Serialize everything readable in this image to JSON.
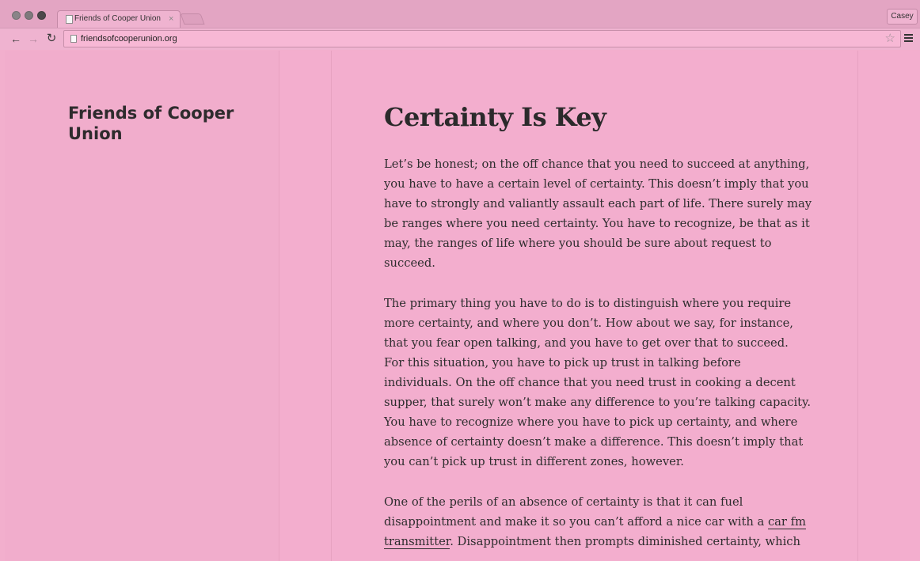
{
  "browser": {
    "tab_title": "Friends of Cooper Union",
    "tab_close": "×",
    "profile": "Casey",
    "url": "friendsofcooperunion.org",
    "back_glyph": "←",
    "forward_glyph": "→",
    "reload_glyph": "↻",
    "star_glyph": "☆"
  },
  "site": {
    "title": "Friends of Cooper Union"
  },
  "post": {
    "title": "Certainty Is Key",
    "paragraphs": [
      "Let’s be honest; on the off chance that you need to succeed at anything, you have to have a certain level of certainty. This doesn’t imply that you have to strongly and valiantly assault each part of life. There surely may be ranges where you need certainty. You have to recognize, be that as it may, the ranges of life where you should be sure about request to succeed.",
      "The primary thing you have to do is to distinguish where you require more certainty, and where you don’t. How about we say, for instance, that you fear open talking, and you have to get over that to succeed. For this situation, you have to pick up trust in talking before individuals. On the off chance that you need trust in cooking a decent supper, that surely won’t make any difference to you’re talking capacity. You have to recognize where you have to pick up certainty, and where absence of certainty doesn’t make a difference. This doesn’t imply that you can’t pick up trust in different zones, however."
    ],
    "p3_before": "One of the perils of an absence of certainty is that it can fuel disappointment and make it so you can’t afford a nice car with a ",
    "p3_link": "car fm transmitter",
    "p3_after": ". Disappointment then prompts diminished certainty, which"
  },
  "colors": {
    "page_bg": "#f3aece",
    "text": "#2e2d2e"
  }
}
